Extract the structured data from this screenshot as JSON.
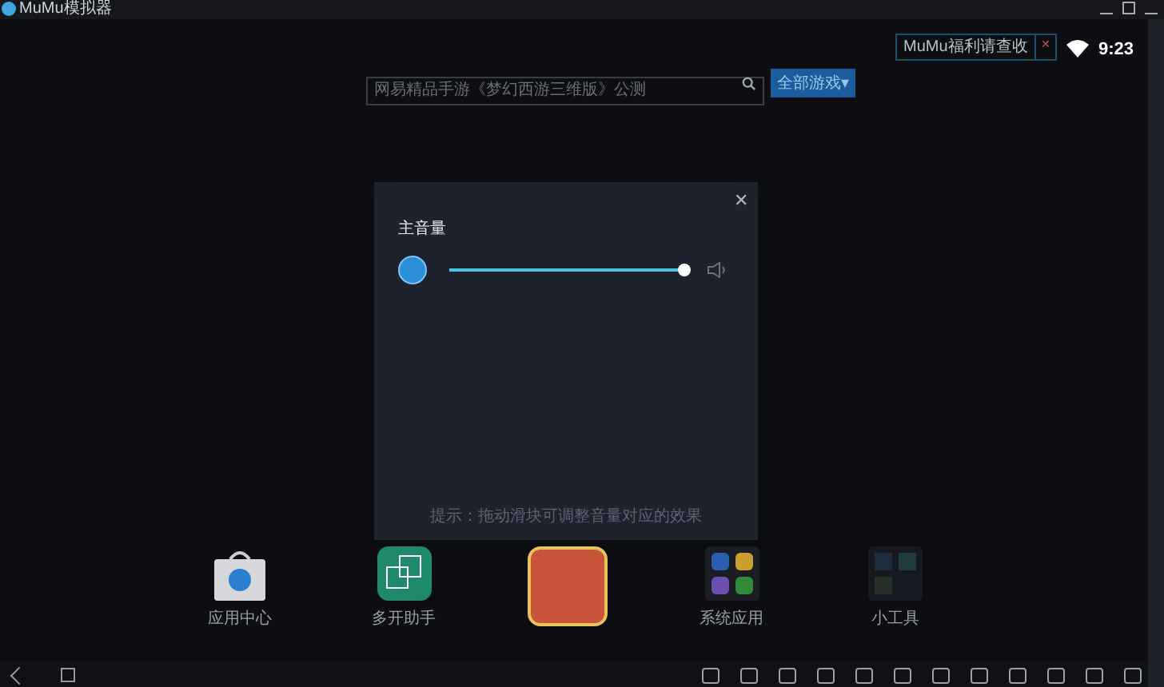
{
  "window": {
    "title": "MuMu模拟器"
  },
  "search": {
    "placeholder": "网易精品手游《梦幻西游三维版》公测",
    "button": "全部游戏▾"
  },
  "notice": {
    "text": "MuMu福利请查收",
    "close": "✕"
  },
  "status_bar": {
    "time": "9:23"
  },
  "volume_dialog": {
    "title": "主音量",
    "close": "✕",
    "level": 1,
    "hint": "提示：拖动滑块可调整音量对应的效果"
  },
  "apps": [
    {
      "label": "应用中心",
      "kind": "store"
    },
    {
      "label": "多开助手",
      "kind": "multi"
    },
    {
      "kind": "game"
    },
    {
      "label": "系统应用",
      "kind": "system"
    },
    {
      "label": "小工具",
      "kind": "tools"
    }
  ]
}
